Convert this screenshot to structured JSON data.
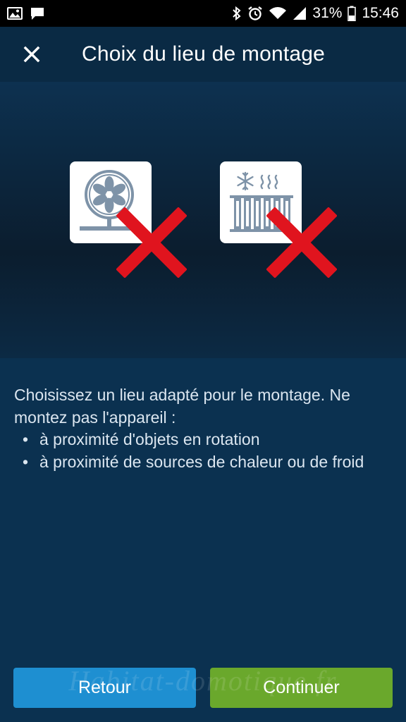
{
  "status_bar": {
    "left_icons": [
      "gallery-icon",
      "message-icon"
    ],
    "right_icons": [
      "bluetooth-icon",
      "alarm-icon",
      "wifi-icon",
      "signal-icon",
      "battery-icon"
    ],
    "battery": "31%",
    "time": "15:46"
  },
  "app_bar": {
    "close_icon": "close-icon",
    "title": "Choix du lieu de montage"
  },
  "illustration": {
    "icons": [
      "fan-icon",
      "heater-icon"
    ],
    "cross_color": "#e0141e"
  },
  "content": {
    "intro": "Choisissez un lieu adapté pour le montage. Ne montez pas l'appareil :",
    "bullets": [
      "à proximité d'objets en rotation",
      "à proximité de sources de chaleur ou de froid"
    ],
    "bullet_char": "•"
  },
  "buttons": {
    "back": "Retour",
    "next": "Continuer",
    "back_color": "#1e8fd1",
    "next_color": "#6aa82c"
  },
  "watermark": "Habitat-domotique.fr"
}
